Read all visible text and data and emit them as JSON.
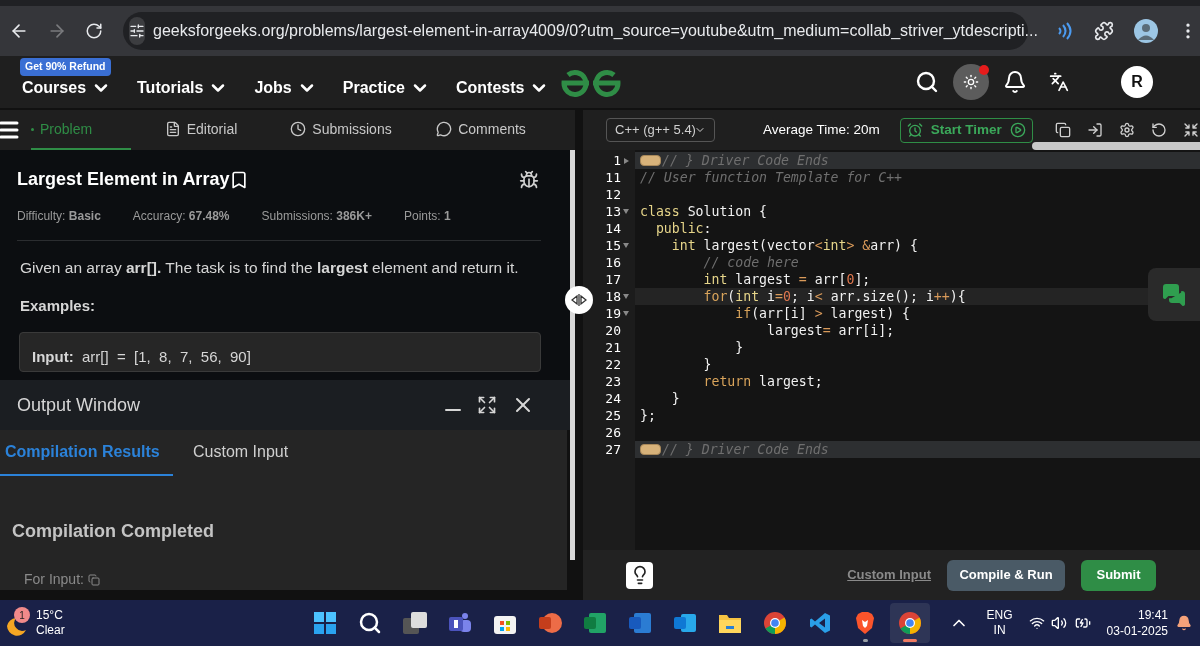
{
  "browser": {
    "url": "geeksforgeeks.org/problems/largest-element-in-array4009/0?utm_source=youtube&utm_medium=collab_striver_ytdescripti...",
    "forward_disabled": true
  },
  "header": {
    "badge": "Get 90% Refund",
    "nav": [
      {
        "label": "Courses"
      },
      {
        "label": "Tutorials"
      },
      {
        "label": "Jobs"
      },
      {
        "label": "Practice"
      },
      {
        "label": "Contests"
      }
    ],
    "theme_notification": true,
    "avatar": "R"
  },
  "problem_tabs": [
    {
      "label": "Problem",
      "kind": "problem",
      "selected": true
    },
    {
      "label": "Editorial",
      "kind": "editorial",
      "selected": false
    },
    {
      "label": "Submissions",
      "kind": "submissions",
      "selected": false
    },
    {
      "label": "Comments",
      "kind": "comments",
      "selected": false
    }
  ],
  "problem": {
    "title": "Largest Element in Array",
    "stats": [
      "Difficulty: **Basic**",
      "Accuracy: **67.48%**",
      "Submissions: **386K+**",
      "Points: **1**"
    ],
    "description": "Given an array **arr[].** The task is to find the **largest** element and return it.",
    "examples_heading": "Examples:",
    "example_input": "**Input:**  arr[]  =  [1,  8,  7,  56,  90]"
  },
  "output_window": {
    "title": "Output Window",
    "tabs": [
      {
        "label": "Compilation Results",
        "selected": true
      },
      {
        "label": "Custom Input",
        "selected": false
      }
    ],
    "status": "Compilation Completed",
    "for_input": "For Input:"
  },
  "editor": {
    "language": "C++ (g++ 5.4)",
    "average_time": "Average Time: 20m",
    "timer_button": "Start Timer",
    "lines": [
      {
        "number": "1",
        "foldable": true,
        "folded": true,
        "selected": false,
        "segments": [
          {
            "text": "// } Driver Code Ends",
            "kind": "comment"
          }
        ]
      },
      {
        "number": "11",
        "foldable": false,
        "folded": false,
        "selected": false,
        "segments": [
          {
            "text": "// User function Template for C++",
            "kind": "comment"
          }
        ]
      },
      {
        "number": "12",
        "foldable": false,
        "folded": false,
        "selected": false
      },
      {
        "number": "13",
        "foldable": true,
        "folded": false,
        "selected": false,
        "segments": [
          {
            "text": "class",
            "kind": "keyword"
          },
          {
            "text": " Solution {",
            "kind": "plain"
          }
        ]
      },
      {
        "number": "14",
        "foldable": false,
        "folded": false,
        "selected": false,
        "segments": [
          {
            "text": "  public",
            "kind": "keyword"
          },
          {
            "text": ":",
            "kind": "plain"
          }
        ]
      },
      {
        "number": "15",
        "foldable": true,
        "folded": false,
        "selected": false,
        "segments": [
          {
            "text": "    int",
            "kind": "keyword"
          },
          {
            "text": " largest(vector",
            "kind": "plain"
          },
          {
            "text": "<",
            "kind": "operator"
          },
          {
            "text": "int",
            "kind": "keyword"
          },
          {
            "text": "> &",
            "kind": "operator"
          },
          {
            "text": "arr) {",
            "kind": "plain"
          }
        ]
      },
      {
        "number": "16",
        "foldable": false,
        "folded": false,
        "selected": false,
        "segments": [
          {
            "text": "        // code here",
            "kind": "comment"
          }
        ]
      },
      {
        "number": "17",
        "foldable": false,
        "folded": false,
        "selected": false,
        "segments": [
          {
            "text": "        int",
            "kind": "keyword"
          },
          {
            "text": " largest ",
            "kind": "plain"
          },
          {
            "text": "=",
            "kind": "operator"
          },
          {
            "text": " arr[",
            "kind": "plain"
          },
          {
            "text": "0",
            "kind": "number"
          },
          {
            "text": "];",
            "kind": "plain"
          }
        ]
      },
      {
        "number": "18",
        "foldable": true,
        "folded": false,
        "selected": true,
        "segments": [
          {
            "text": "        for",
            "kind": "control"
          },
          {
            "text": "(",
            "kind": "plain"
          },
          {
            "text": "int",
            "kind": "keyword"
          },
          {
            "text": " i",
            "kind": "plain"
          },
          {
            "text": "=",
            "kind": "operator"
          },
          {
            "text": "0",
            "kind": "number"
          },
          {
            "text": "; i",
            "kind": "plain"
          },
          {
            "text": "<",
            "kind": "operator"
          },
          {
            "text": " arr.size(); i",
            "kind": "plain"
          },
          {
            "text": "++",
            "kind": "operator"
          },
          {
            "text": "){",
            "kind": "plain"
          }
        ]
      },
      {
        "number": "19",
        "foldable": true,
        "folded": false,
        "selected": false,
        "segments": [
          {
            "text": "            if",
            "kind": "control"
          },
          {
            "text": "(arr[i] ",
            "kind": "plain"
          },
          {
            "text": ">",
            "kind": "operator"
          },
          {
            "text": " largest) {",
            "kind": "plain"
          }
        ]
      },
      {
        "number": "20",
        "foldable": false,
        "folded": false,
        "selected": false,
        "segments": [
          {
            "text": "                largest",
            "kind": "plain"
          },
          {
            "text": "=",
            "kind": "operator"
          },
          {
            "text": " arr[i];",
            "kind": "plain"
          }
        ]
      },
      {
        "number": "21",
        "foldable": false,
        "folded": false,
        "selected": false,
        "segments": [
          {
            "text": "            }",
            "kind": "plain"
          }
        ]
      },
      {
        "number": "22",
        "foldable": false,
        "folded": false,
        "selected": false,
        "segments": [
          {
            "text": "        }",
            "kind": "plain"
          }
        ]
      },
      {
        "number": "23",
        "foldable": false,
        "folded": false,
        "selected": false,
        "segments": [
          {
            "text": "        return",
            "kind": "control"
          },
          {
            "text": " largest;",
            "kind": "plain"
          }
        ]
      },
      {
        "number": "24",
        "foldable": false,
        "folded": false,
        "selected": false,
        "segments": [
          {
            "text": "    }",
            "kind": "plain"
          }
        ]
      },
      {
        "number": "25",
        "foldable": false,
        "folded": false,
        "selected": false,
        "segments": [
          {
            "text": "};",
            "kind": "plain"
          }
        ]
      },
      {
        "number": "26",
        "foldable": false,
        "folded": false,
        "selected": false
      },
      {
        "number": "27",
        "foldable": false,
        "folded": true,
        "selected": false,
        "segments": [
          {
            "text": "// } Driver Code Ends",
            "kind": "comment"
          }
        ]
      }
    ],
    "custom_input_link": "Custom Input",
    "run_button": "Compile & Run",
    "submit_button": "Submit"
  },
  "taskbar": {
    "weather": {
      "badge": "1",
      "temperature": "15°C",
      "condition": "Clear"
    },
    "apps": [
      {
        "kind": "start",
        "running": false,
        "active": false
      },
      {
        "kind": "search",
        "running": false,
        "active": false
      },
      {
        "kind": "task-view",
        "running": false,
        "active": false
      },
      {
        "kind": "teams",
        "running": false,
        "active": false
      },
      {
        "kind": "store",
        "running": false,
        "active": false
      },
      {
        "kind": "powerpoint",
        "running": false,
        "active": false
      },
      {
        "kind": "excel",
        "running": false,
        "active": false
      },
      {
        "kind": "word",
        "running": false,
        "active": false
      },
      {
        "kind": "outlook",
        "running": false,
        "active": false
      },
      {
        "kind": "files",
        "running": false,
        "active": false
      },
      {
        "kind": "chrome",
        "running": false,
        "active": false
      },
      {
        "kind": "vscode",
        "running": false,
        "active": false
      },
      {
        "kind": "brave",
        "running": true,
        "active": false
      },
      {
        "kind": "chrome-profile",
        "running": true,
        "active": true
      }
    ],
    "language": "ENG",
    "region": "IN",
    "time": "19:41",
    "date": "03-01-2025"
  }
}
